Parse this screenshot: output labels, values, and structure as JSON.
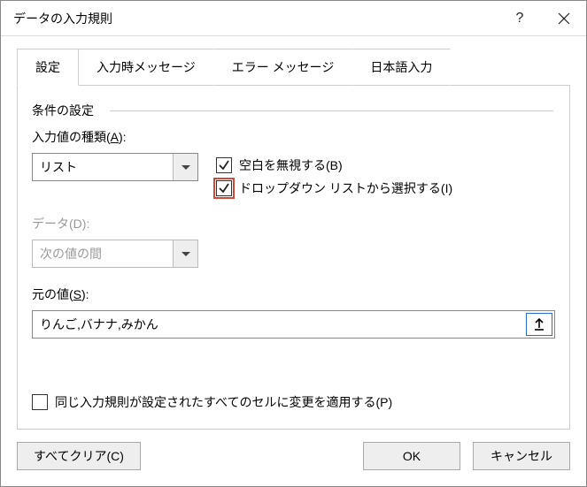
{
  "window": {
    "title": "データの入力規則"
  },
  "tabs": [
    "設定",
    "入力時メッセージ",
    "エラー メッセージ",
    "日本語入力"
  ],
  "active_tab_index": 0,
  "fieldset": {
    "legend": "条件の設定"
  },
  "allow": {
    "label_prefix": "入力値の種類(",
    "label_key": "A",
    "label_suffix": "):",
    "value": "リスト"
  },
  "data": {
    "label_prefix": "データ(",
    "label_key": "D",
    "label_suffix": "):",
    "value": "次の値の間",
    "disabled": true
  },
  "ignore_blank": {
    "label_prefix": "空白を無視する(",
    "label_key": "B",
    "label_suffix": ")",
    "checked": true
  },
  "dropdown": {
    "label_prefix": "ドロップダウン リストから選択する(",
    "label_key": "I",
    "label_suffix": ")",
    "checked": true,
    "highlighted": true
  },
  "source": {
    "label_prefix": "元の値(",
    "label_key": "S",
    "label_suffix": "):",
    "value": "りんご,バナナ,みかん"
  },
  "apply_all": {
    "label_prefix": "同じ入力規則が設定されたすべてのセルに変更を適用する(",
    "label_key": "P",
    "label_suffix": ")",
    "checked": false
  },
  "buttons": {
    "clear_prefix": "すべてクリア(",
    "clear_key": "C",
    "clear_suffix": ")",
    "ok": "OK",
    "cancel": "キャンセル"
  }
}
